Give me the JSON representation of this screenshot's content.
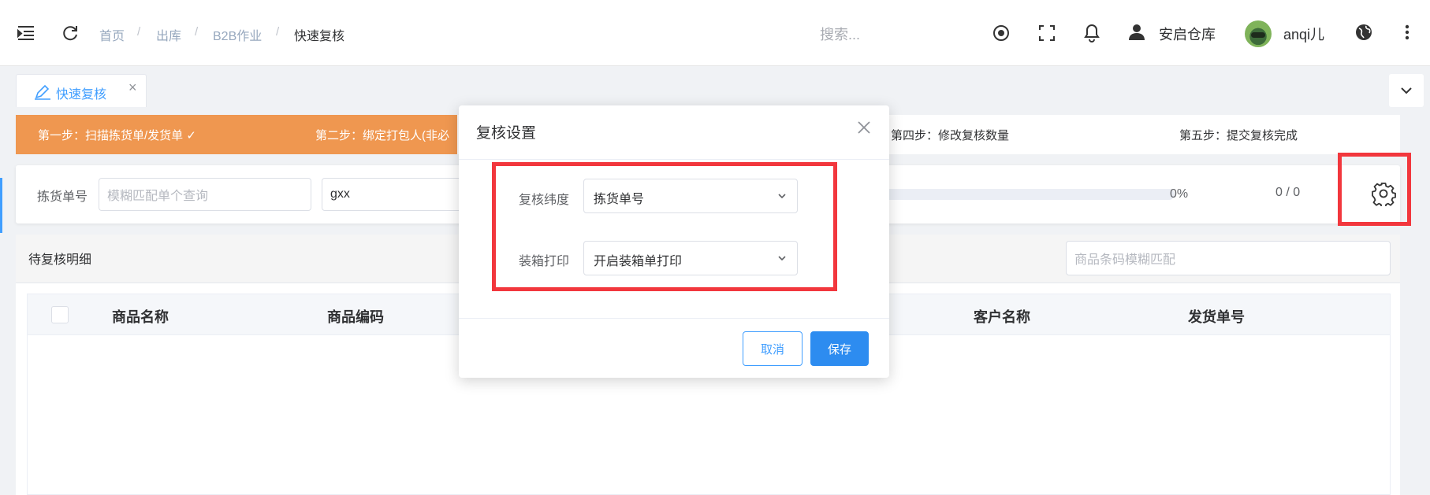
{
  "header": {
    "breadcrumbs": [
      "首页",
      "出库",
      "B2B作业",
      "快速复核"
    ],
    "search_placeholder": "搜索...",
    "warehouse": "安启仓库",
    "username": "anqi儿",
    "icons": [
      "menu-fold-icon",
      "refresh-icon",
      "record-icon",
      "fullscreen-icon",
      "bell-icon",
      "user-icon",
      "avatar",
      "globe-icon",
      "more-vertical-icon"
    ]
  },
  "tags": {
    "active_tab": "快速复核",
    "close_glyph": "×"
  },
  "steps": {
    "step1": "第一步：扫描拣货单/发货单 ✓",
    "step2": "第二步：绑定打包人(非必",
    "step4": "第四步：修改复核数量",
    "step5": "第五步：提交复核完成",
    "active_color": "#ef9750"
  },
  "scan": {
    "label": "拣货单号",
    "input_placeholder": "模糊匹配单个查询",
    "second_input_value": "gxx",
    "progress": 0,
    "progress_text": "0%",
    "count_text": "0 / 0"
  },
  "detail": {
    "title": "待复核明细",
    "barcode_placeholder": "商品条码模糊匹配",
    "columns": [
      "商品名称",
      "商品编码",
      "客户名称",
      "发货单号"
    ]
  },
  "modal": {
    "title": "复核设置",
    "fields": [
      {
        "label": "复核纬度",
        "value": "拣货单号"
      },
      {
        "label": "装箱打印",
        "value": "开启装箱单打印"
      }
    ],
    "cancel_label": "取消",
    "save_label": "保存"
  },
  "colors": {
    "primary": "#409eff",
    "highlight": "#f2373d"
  }
}
